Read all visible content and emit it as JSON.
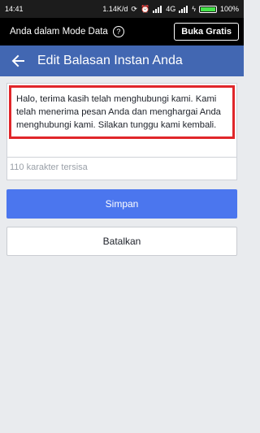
{
  "status_bar": {
    "time": "14:41",
    "network_speed": "1.14K/d",
    "network_type": "4G",
    "battery_percent": "100%"
  },
  "data_mode_bar": {
    "text": "Anda dalam Mode Data",
    "help_icon": "?",
    "free_button": "Buka Gratis"
  },
  "app_bar": {
    "title": "Edit Balasan Instan Anda",
    "back_icon": "arrow-left-icon"
  },
  "reply_field": {
    "value": "Halo, terima kasih telah menghubungi kami. Kami telah menerima pesan Anda dan menghargai Anda menghubungi kami. Silakan tunggu kami kembali.",
    "counter": "110 karakter tersisa"
  },
  "buttons": {
    "save": "Simpan",
    "cancel": "Batalkan"
  },
  "colors": {
    "app_bar": "#4267b2",
    "save_button": "#4b76ee",
    "highlight": "#e0262a"
  }
}
